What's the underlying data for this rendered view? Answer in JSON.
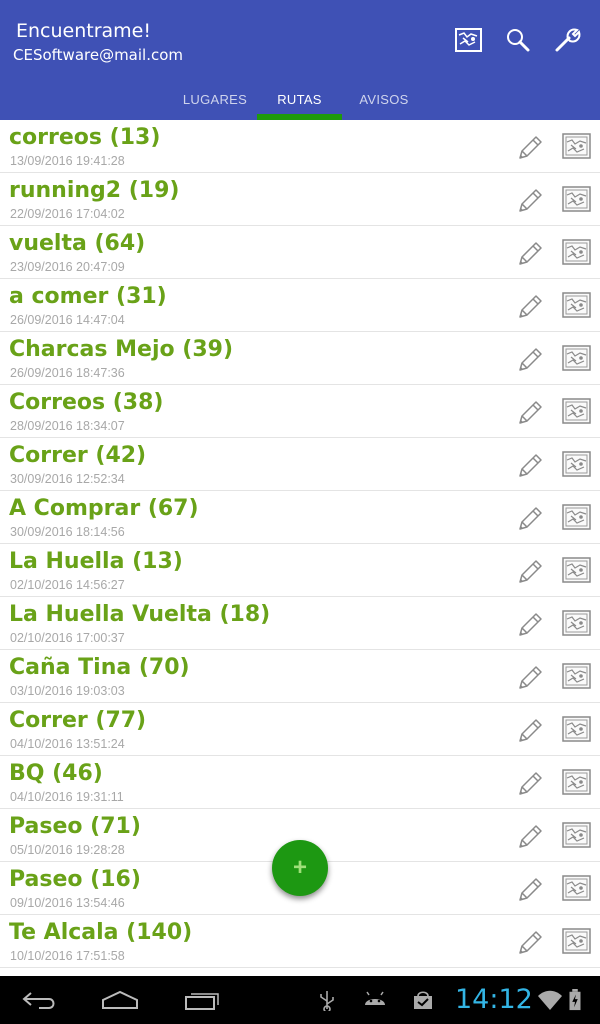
{
  "appbar": {
    "title": "Encuentrame!",
    "subtitle": "CESoftware@mail.com",
    "actions": [
      "map-icon",
      "search-icon",
      "wrench-icon"
    ],
    "color": "#3f51b5"
  },
  "tabs": [
    {
      "label": "LUGARES",
      "active": false
    },
    {
      "label": "RUTAS",
      "active": true
    },
    {
      "label": "AVISOS",
      "active": false
    }
  ],
  "routes": [
    {
      "name": "correos (13)",
      "date": "13/09/2016 19:41:28"
    },
    {
      "name": "running2 (19)",
      "date": "22/09/2016 17:04:02"
    },
    {
      "name": "vuelta (64)",
      "date": "23/09/2016 20:47:09"
    },
    {
      "name": "a comer (31)",
      "date": "26/09/2016 14:47:04"
    },
    {
      "name": "Charcas Mejo (39)",
      "date": "26/09/2016 18:47:36"
    },
    {
      "name": "Correos (38)",
      "date": "28/09/2016 18:34:07"
    },
    {
      "name": "Correr (42)",
      "date": "30/09/2016 12:52:34"
    },
    {
      "name": "A Comprar (67)",
      "date": "30/09/2016 18:14:56"
    },
    {
      "name": "La Huella (13)",
      "date": "02/10/2016 14:56:27"
    },
    {
      "name": "La Huella Vuelta (18)",
      "date": "02/10/2016 17:00:37"
    },
    {
      "name": "Caña Tina (70)",
      "date": "03/10/2016 19:03:03"
    },
    {
      "name": "Correr (77)",
      "date": "04/10/2016 13:51:24"
    },
    {
      "name": "BQ (46)",
      "date": "04/10/2016 19:31:11"
    },
    {
      "name": "Paseo (71)",
      "date": "05/10/2016 19:28:28"
    },
    {
      "name": "Paseo (16)",
      "date": "09/10/2016 13:54:46"
    },
    {
      "name": "Te Alcala (140)",
      "date": "10/10/2016 17:51:58"
    }
  ],
  "fab": {
    "label": "+",
    "color": "#1d9812"
  },
  "system": {
    "clock": "14:12",
    "nav": [
      "back-icon",
      "home-icon",
      "recent-apps-icon"
    ],
    "status_icons": [
      "usb-icon",
      "android-icon",
      "shopping-bag-icon",
      "wifi-icon",
      "battery-icon"
    ]
  }
}
